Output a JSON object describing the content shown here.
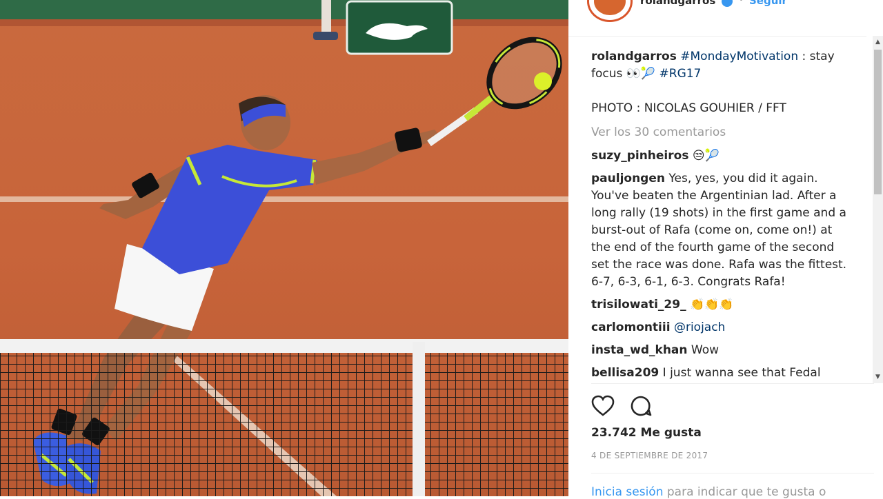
{
  "header": {
    "username": "rolandgarros",
    "separator": "•",
    "follow_label": "Seguir"
  },
  "caption": {
    "user": "rolandgarros",
    "hashtag1": "#MondayMotivation",
    "text": " : stay focus 👀🎾 ",
    "hashtag2": "#RG17"
  },
  "photo_credit": "PHOTO : NICOLAS GOUHIER / FFT",
  "view_all_comments": "Ver los 30 comentarios",
  "comments": [
    {
      "user": "suzy_pinheiros",
      "text": " 😒🎾"
    },
    {
      "user": "pauljongen",
      "text": " Yes, yes, you did it again. You've beaten the Argentinian lad. After a long rally (19 shots) in the first game and a burst-out of Rafa (come on, come on!) at the end of the fourth game of the second set the race was done. Rafa was the fittest. 6-7, 6-3, 6-1, 6-3. Congrats Rafa!"
    },
    {
      "user": "trisilowati_29_",
      "text": " 👏👏👏"
    },
    {
      "user": "carlomontiii",
      "mention": "@riojach"
    },
    {
      "user": "insta_wd_khan",
      "text": " Wow"
    },
    {
      "user": "bellisa209",
      "text": " I just wanna see that Fedal semi."
    }
  ],
  "likes": "23.742 Me gusta",
  "date": "4 DE SEPTIEMBRE DE 2017",
  "login_prompt": {
    "link": "Inicia sesión",
    "text": " para indicar que te gusta o"
  },
  "photo": {
    "sign_brand": "LACOSTE",
    "clay_color": "#c8643a",
    "shirt_color": "#3c4fd8",
    "accent_color": "#c6e837"
  },
  "colors": {
    "link": "#3897f0",
    "hashtag": "#003569",
    "muted": "#999999"
  }
}
